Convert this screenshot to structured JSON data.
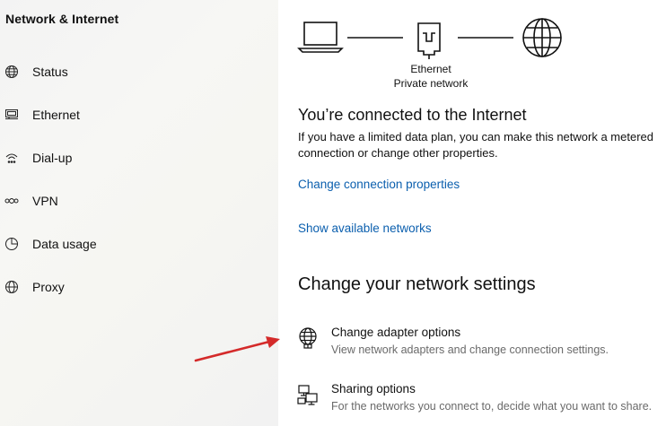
{
  "sidebar": {
    "title": "Network & Internet",
    "items": [
      {
        "label": "Status",
        "icon": "globe-icon"
      },
      {
        "label": "Ethernet",
        "icon": "ethernet-icon"
      },
      {
        "label": "Dial-up",
        "icon": "dialup-icon"
      },
      {
        "label": "VPN",
        "icon": "vpn-icon"
      },
      {
        "label": "Data usage",
        "icon": "data-usage-icon"
      },
      {
        "label": "Proxy",
        "icon": "globe-icon"
      }
    ]
  },
  "main": {
    "diagram": {
      "caption_line1": "Ethernet",
      "caption_line2": "Private network"
    },
    "status_heading": "You’re connected to the Internet",
    "status_text": "If you have a limited data plan, you can make this network a metered connection or change other properties.",
    "change_properties_link": "Change connection properties",
    "show_networks_link": "Show available networks",
    "settings_heading": "Change your network settings",
    "options": [
      {
        "title": "Change adapter options",
        "desc": "View network adapters and change connection settings.",
        "icon": "adapter-globe-icon"
      },
      {
        "title": "Sharing options",
        "desc": "For the networks you connect to, decide what you want to share.",
        "icon": "sharing-icon"
      }
    ]
  },
  "colors": {
    "link": "#0b5fae",
    "annotation_arrow": "#d42a2a"
  }
}
